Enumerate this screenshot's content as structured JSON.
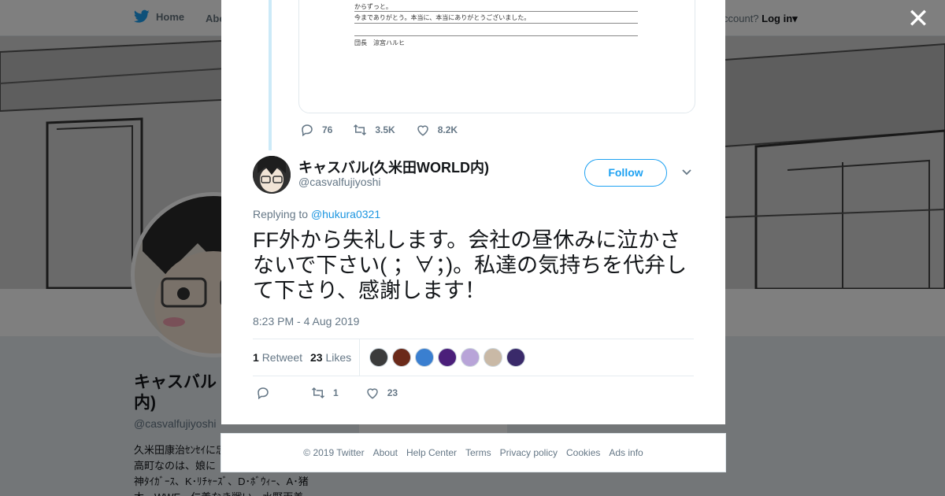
{
  "background": {
    "nav": {
      "home_label": "Home",
      "about_label": "Abo",
      "account_prompt": "ccount?",
      "login_label": "Log in"
    },
    "profile": {
      "name": "キャスバル",
      "name_line2": "内)",
      "handle": "@casvalfujiyoshi",
      "bio": "久米田康治ｾﾝｾｲに忠\n高町なのは、娘に\n神ﾀｲｶﾞｰｽ、K･ﾘﾁｬｰｽﾞ、D･ﾎﾞｳｨｰ、A･猪\n木、WWE、仁義なき戦い、水野両美"
    }
  },
  "modal": {
    "close_icon": "close-icon",
    "parent_tweet": {
      "document_lines": [
        "からずっと。",
        "今までありがとう。本当に、本当にありがとうございました。",
        "団長　涼宮ハルヒ"
      ],
      "replies": "76",
      "retweets": "3.5K",
      "likes": "8.2K"
    },
    "tweet": {
      "author_name": "キャスバル(久米田WORLD内)",
      "author_handle": "@casvalfujiyoshi",
      "follow_label": "Follow",
      "replying_prefix": "Replying to",
      "replying_to": "@hukura0321",
      "text": "FF外から失礼します。会社の昼休みに泣かさないで下さい( ；∀；)。私達の気持ちを代弁して下さり、感謝します！",
      "timestamp": "8:23 PM - 4 Aug 2019",
      "retweet_count": "1",
      "retweet_label": "Retweet",
      "like_count": "23",
      "like_label": "Likes",
      "action_retweets": "1",
      "action_likes": "23"
    },
    "liker_colors": [
      "#3b3b3b",
      "#6b2a1a",
      "#3a7fd0",
      "#4b1f7a",
      "#b8a4d8",
      "#c9b9a6",
      "#3a2a6a"
    ]
  },
  "footer": {
    "items": [
      "© 2019 Twitter",
      "About",
      "Help Center",
      "Terms",
      "Privacy policy",
      "Cookies",
      "Ads info"
    ]
  },
  "colors": {
    "accent": "#1da1f2",
    "text": "#14171a",
    "muted": "#657786"
  }
}
